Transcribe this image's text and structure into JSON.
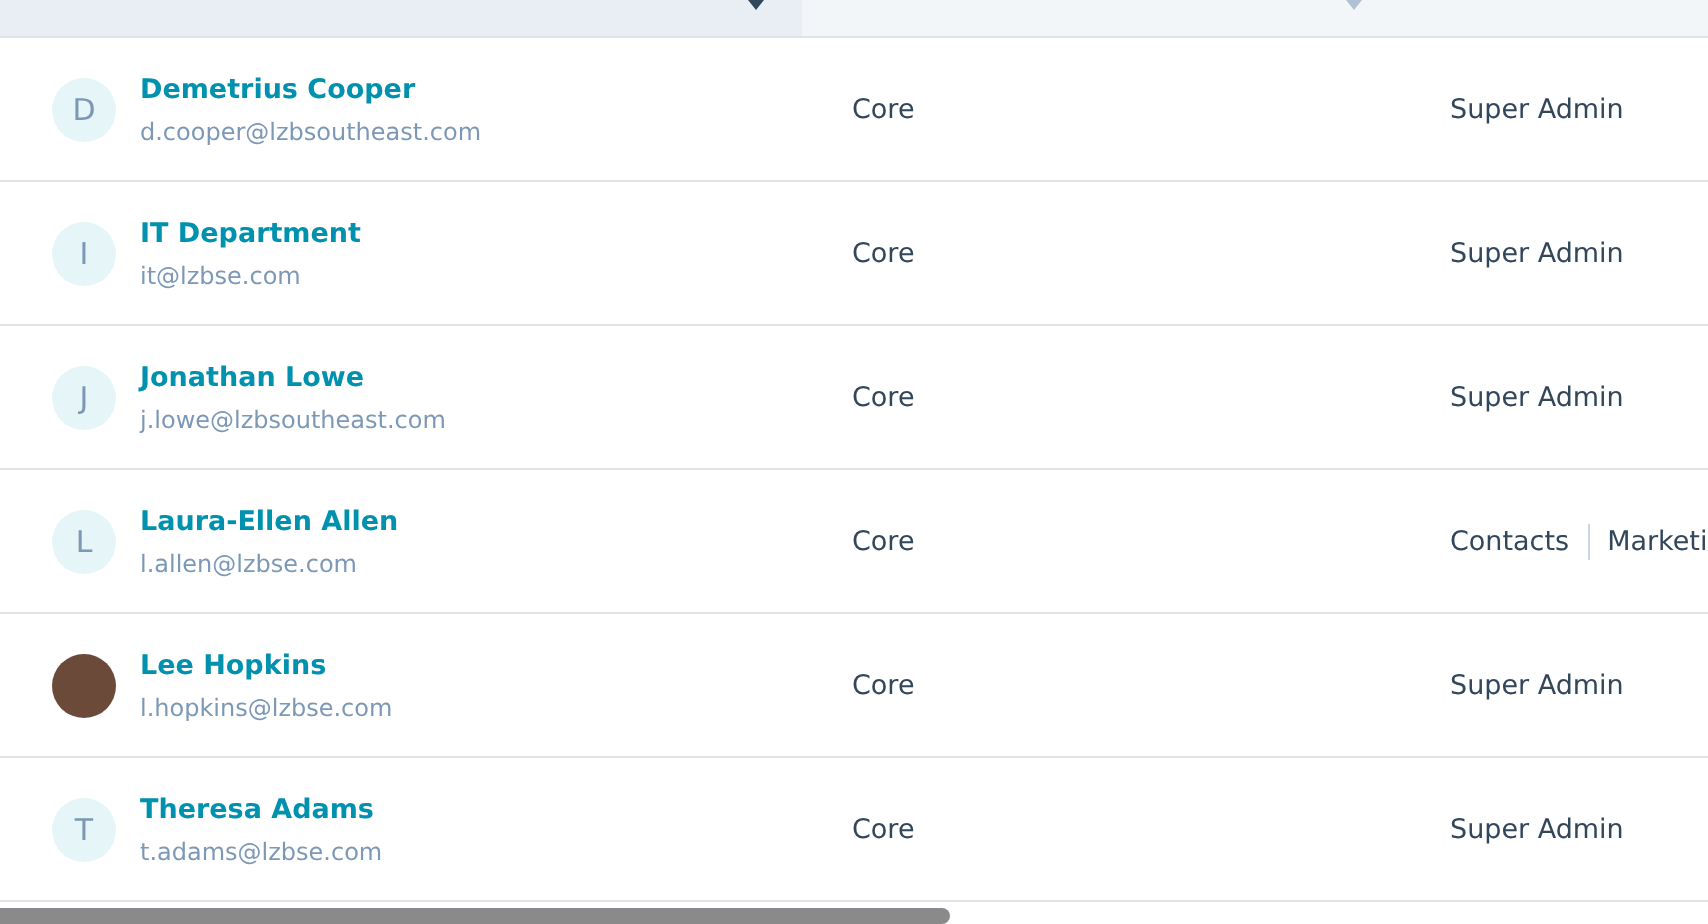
{
  "table": {
    "columns": [
      {
        "sorted": true
      },
      {
        "sorted": false
      },
      {
        "sorted": false
      }
    ],
    "rows": [
      {
        "avatar": {
          "kind": "initial",
          "letter": "D"
        },
        "name": "Demetrius Cooper",
        "email": "d.cooper@lzbsoutheast.com",
        "seat": "Core",
        "access": [
          "Super Admin"
        ]
      },
      {
        "avatar": {
          "kind": "initial",
          "letter": "I"
        },
        "name": "IT Department",
        "email": "it@lzbse.com",
        "seat": "Core",
        "access": [
          "Super Admin"
        ]
      },
      {
        "avatar": {
          "kind": "initial",
          "letter": "J"
        },
        "name": "Jonathan Lowe",
        "email": "j.lowe@lzbsoutheast.com",
        "seat": "Core",
        "access": [
          "Super Admin"
        ]
      },
      {
        "avatar": {
          "kind": "initial",
          "letter": "L"
        },
        "name": "Laura-Ellen Allen",
        "email": "l.allen@lzbse.com",
        "seat": "Core",
        "access": [
          "Contacts",
          "Marketi"
        ]
      },
      {
        "avatar": {
          "kind": "photo"
        },
        "name": "Lee Hopkins",
        "email": "l.hopkins@lzbse.com",
        "seat": "Core",
        "access": [
          "Super Admin"
        ]
      },
      {
        "avatar": {
          "kind": "initial",
          "letter": "T"
        },
        "name": "Theresa Adams",
        "email": "t.adams@lzbse.com",
        "seat": "Core",
        "access": [
          "Super Admin"
        ]
      }
    ]
  }
}
